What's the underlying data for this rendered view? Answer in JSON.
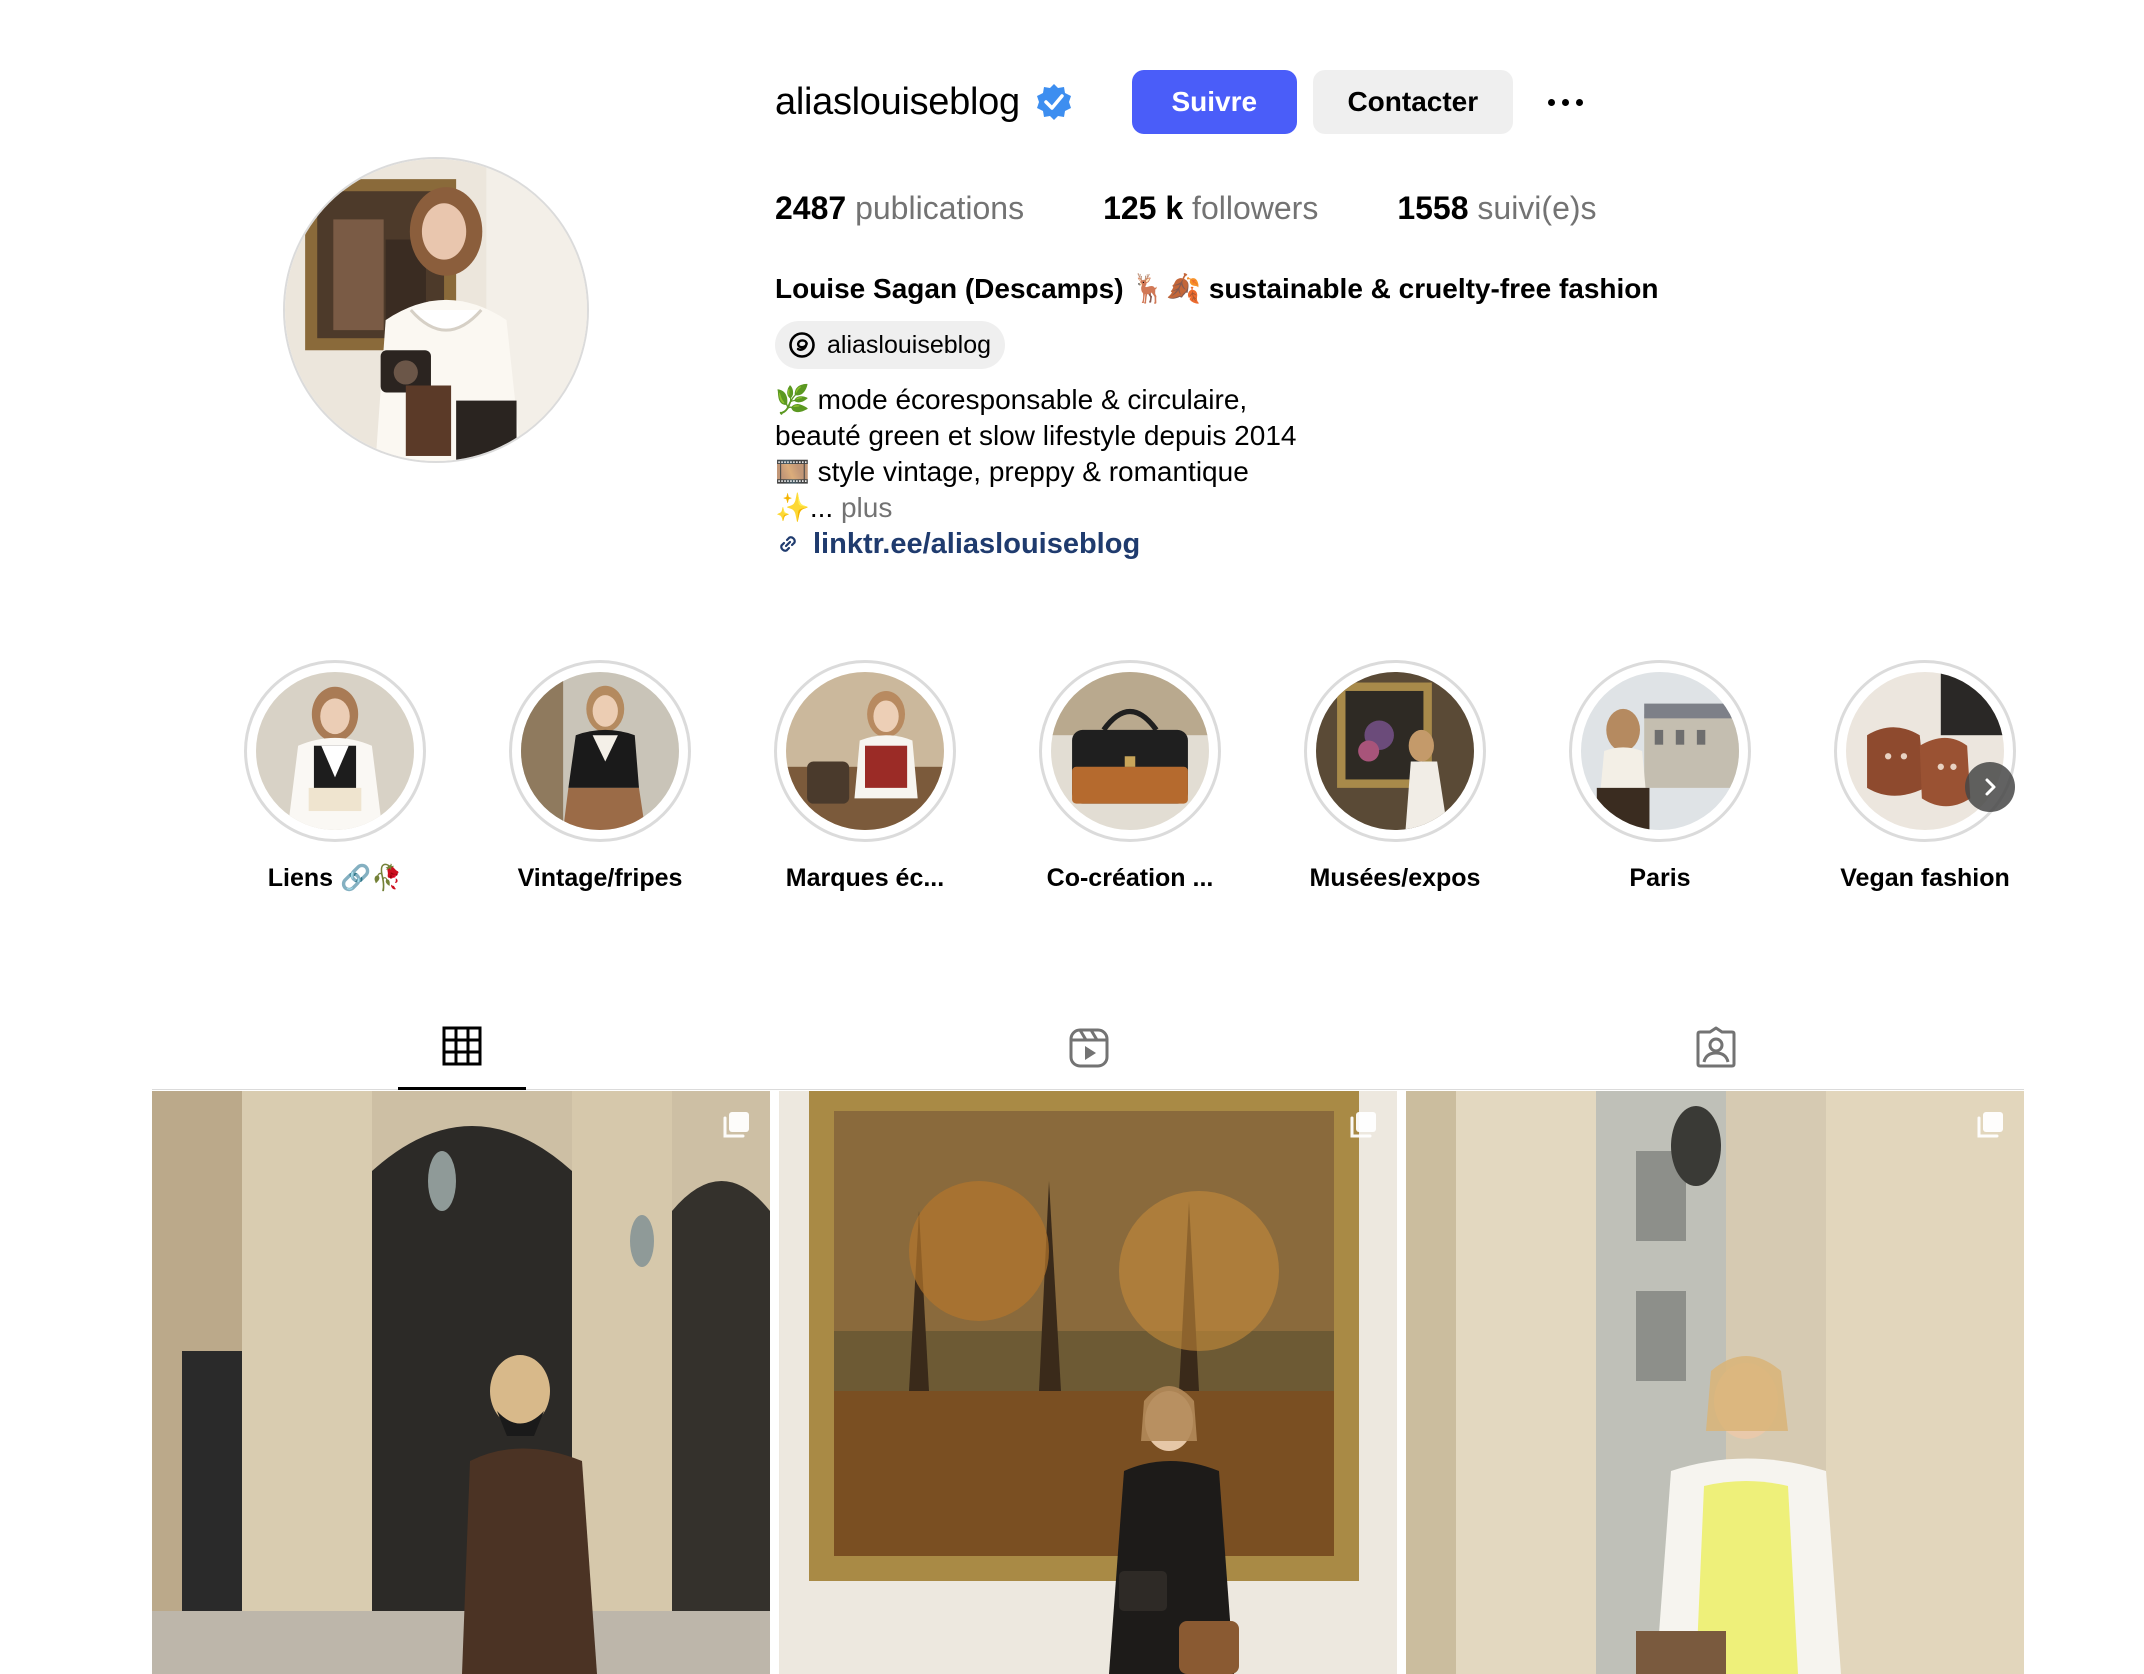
{
  "profile": {
    "username": "aliaslouiseblog",
    "verified": true,
    "follow_label": "Suivre",
    "contact_label": "Contacter",
    "more_icon": "more-horizontal-icon",
    "accent_color": "#4a5df9",
    "verified_color": "#3d8ef0"
  },
  "stats": {
    "posts_value": "2487",
    "posts_label": "publications",
    "followers_value": "125 k",
    "followers_label": "followers",
    "following_value": "1558",
    "following_label": "suivi(e)s"
  },
  "bio": {
    "full_name": "Louise Sagan (Descamps) 🦌🍂 sustainable & cruelty-free fashion",
    "threads_handle": "aliaslouiseblog",
    "lines": [
      "🌿 mode écoresponsable & circulaire,",
      "beauté green et slow lifestyle depuis 2014",
      "🎞️ style vintage, preppy & romantique",
      "✨..."
    ],
    "more_label": "plus",
    "link": "linktr.ee/aliaslouiseblog",
    "link_color": "#1f3b6e"
  },
  "highlights": [
    {
      "label": "Liens 🔗🥀"
    },
    {
      "label": "Vintage/fripes"
    },
    {
      "label": "Marques éc..."
    },
    {
      "label": "Co-création ..."
    },
    {
      "label": "Musées/expos"
    },
    {
      "label": "Paris"
    },
    {
      "label": "Vegan fashion"
    }
  ],
  "tabs": [
    {
      "icon": "grid-icon",
      "active": true
    },
    {
      "icon": "reels-icon",
      "active": false
    },
    {
      "icon": "tagged-icon",
      "active": false
    }
  ],
  "posts": [
    {
      "subject": "palais-royal-arcade",
      "carousel": true
    },
    {
      "subject": "museum-painting",
      "carousel": true
    },
    {
      "subject": "colonnade-portrait",
      "carousel": true
    }
  ]
}
